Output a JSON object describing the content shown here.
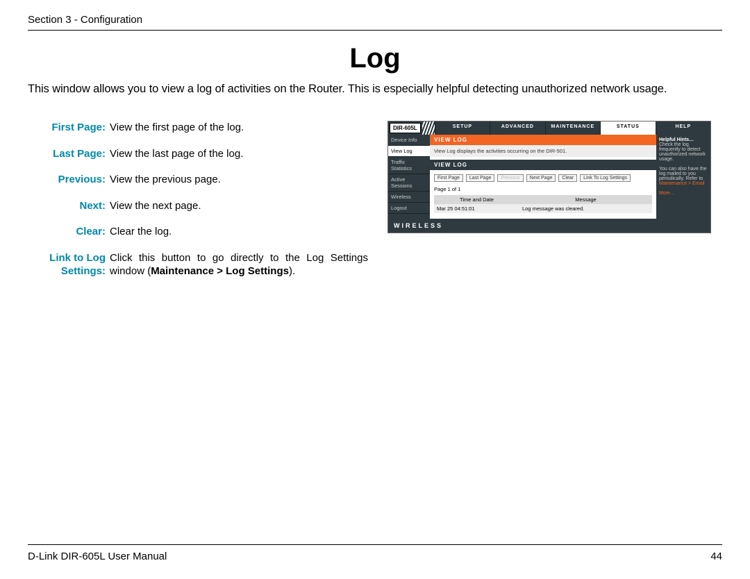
{
  "header": {
    "section": "Section 3 - Configuration"
  },
  "title": "Log",
  "intro": "This window allows you to view a log of activities on the Router. This is especially helpful detecting unauthorized network usage.",
  "definitions": [
    {
      "label": "First Page:",
      "text": "View the first page of the log."
    },
    {
      "label": "Last Page:",
      "text": "View the last page of the log."
    },
    {
      "label": "Previous:",
      "text": "View the previous page."
    },
    {
      "label": "Next:",
      "text": "View the next page."
    },
    {
      "label": "Clear:",
      "text": "Clear the log."
    },
    {
      "label": "Link to Log Settings:",
      "text": "Click this button to go directly to the Log Settings window (",
      "bold": "Maintenance > Log Settings",
      "tail": ")."
    }
  ],
  "shot": {
    "model": "DIR-605L",
    "tabs": [
      "SETUP",
      "ADVANCED",
      "MAINTENANCE",
      "STATUS",
      "HELP"
    ],
    "active_tab": 3,
    "side": [
      "Device Info",
      "View Log",
      "Traffic Statistics",
      "Active Sessions",
      "Wireless",
      "Logout"
    ],
    "active_side": 1,
    "banner": "VIEW LOG",
    "desc": "View Log displays the activities occurring on the DIR-501.",
    "heading": "VIEW LOG",
    "buttons": [
      "First Page",
      "Last Page",
      "Previous",
      "Next Page",
      "Clear",
      "Link To Log Settings"
    ],
    "disabled_buttons": [
      2
    ],
    "page_info": "Page 1 of 1",
    "table": {
      "headers": [
        "Time and Date",
        "Message"
      ],
      "rows": [
        [
          "Mar 25 04:51:01",
          "Log message was cleared."
        ]
      ]
    },
    "help": {
      "title": "Helpful Hints…",
      "line1": "Check the log frequently to detect unauthorized network usage.",
      "line2": "You can also have the log mailed to you periodically. Refer to",
      "link": "Maintenance > Email",
      "more": "More…"
    },
    "brand": "WIRELESS"
  },
  "footer": {
    "left": "D-Link DIR-605L User Manual",
    "page": "44"
  }
}
